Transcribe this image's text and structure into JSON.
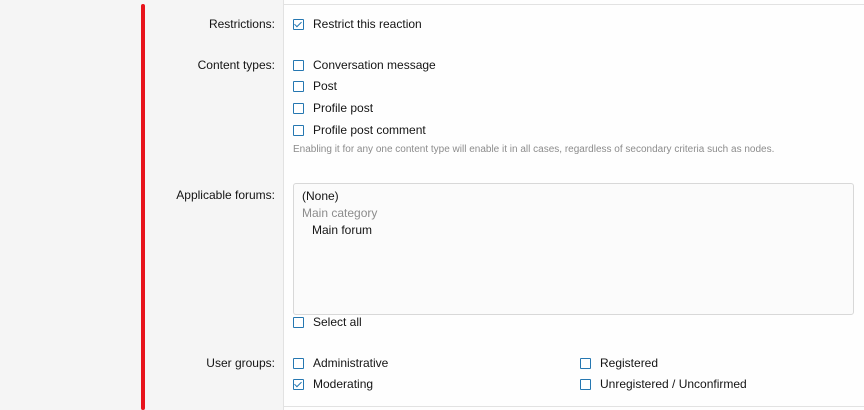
{
  "restrictions": {
    "label": "Restrictions:",
    "option": {
      "label": "Restrict this reaction",
      "checked": true
    }
  },
  "content_types": {
    "label": "Content types:",
    "options": [
      {
        "label": "Conversation message",
        "checked": false
      },
      {
        "label": "Post",
        "checked": false
      },
      {
        "label": "Profile post",
        "checked": false
      },
      {
        "label": "Profile post comment",
        "checked": false
      }
    ],
    "hint": "Enabling it for any one content type will enable it in all cases, regardless of secondary criteria such as nodes."
  },
  "applicable_forums": {
    "label": "Applicable forums:",
    "options": [
      {
        "label": "(None)",
        "type": "option"
      },
      {
        "label": "Main category",
        "type": "group"
      },
      {
        "label": "Main forum",
        "type": "option"
      }
    ],
    "select_all": {
      "label": "Select all",
      "checked": false
    }
  },
  "user_groups": {
    "label": "User groups:",
    "options": [
      {
        "label": "Administrative",
        "checked": false
      },
      {
        "label": "Registered",
        "checked": false
      },
      {
        "label": "Moderating",
        "checked": true
      },
      {
        "label": "Unregistered / Unconfirmed",
        "checked": false
      }
    ]
  },
  "colors": {
    "accent": "#2577b1",
    "annotation": "#e8141c"
  }
}
